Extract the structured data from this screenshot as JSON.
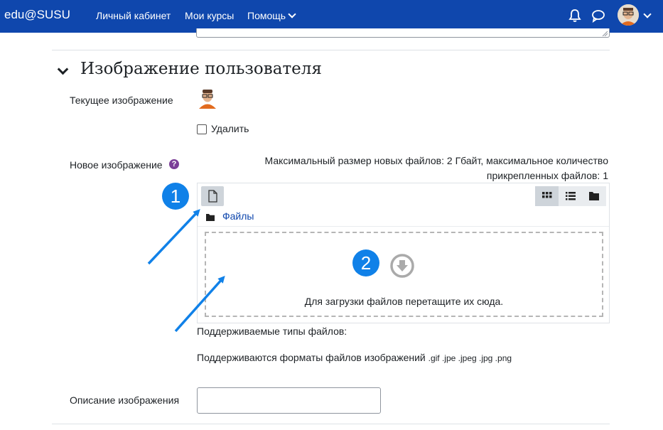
{
  "navbar": {
    "brand": "edu@SUSU",
    "links": [
      "Личный кабинет",
      "Мои курсы",
      "Помощь"
    ]
  },
  "section": {
    "title": "Изображение пользователя"
  },
  "current_image": {
    "label": "Текущее изображение",
    "delete_label": "Удалить"
  },
  "new_image": {
    "label": "Новое изображение",
    "help_glyph": "?",
    "limits": "Максимальный размер новых файлов: 2 Гбайт, максимальное количество прикрепленных файлов: 1"
  },
  "filemanager": {
    "path_label": "Файлы",
    "drop_text": "Для загрузки файлов перетащите их сюда."
  },
  "file_types": {
    "label": "Поддерживаемые типы файлов:",
    "text": "Поддерживаются форматы файлов изображений",
    "extensions": ".gif .jpe .jpeg .jpg .png"
  },
  "description": {
    "label": "Описание изображения",
    "value": ""
  },
  "annotations": {
    "badge1": "1",
    "badge2": "2"
  },
  "colors": {
    "navbar": "#0f47ad",
    "link": "#0f47ad",
    "help": "#7b3e97",
    "annotation": "#1081e8"
  }
}
